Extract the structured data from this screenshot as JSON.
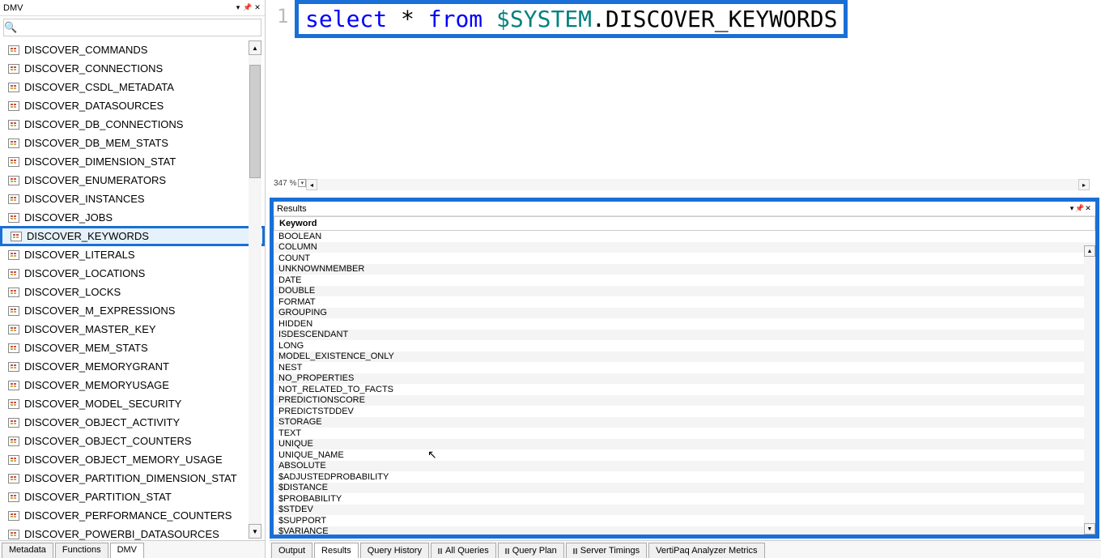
{
  "left": {
    "title": "DMV",
    "search_placeholder": "",
    "items": [
      "DISCOVER_COMMANDS",
      "DISCOVER_CONNECTIONS",
      "DISCOVER_CSDL_METADATA",
      "DISCOVER_DATASOURCES",
      "DISCOVER_DB_CONNECTIONS",
      "DISCOVER_DB_MEM_STATS",
      "DISCOVER_DIMENSION_STAT",
      "DISCOVER_ENUMERATORS",
      "DISCOVER_INSTANCES",
      "DISCOVER_JOBS",
      "DISCOVER_KEYWORDS",
      "DISCOVER_LITERALS",
      "DISCOVER_LOCATIONS",
      "DISCOVER_LOCKS",
      "DISCOVER_M_EXPRESSIONS",
      "DISCOVER_MASTER_KEY",
      "DISCOVER_MEM_STATS",
      "DISCOVER_MEMORYGRANT",
      "DISCOVER_MEMORYUSAGE",
      "DISCOVER_MODEL_SECURITY",
      "DISCOVER_OBJECT_ACTIVITY",
      "DISCOVER_OBJECT_COUNTERS",
      "DISCOVER_OBJECT_MEMORY_USAGE",
      "DISCOVER_PARTITION_DIMENSION_STAT",
      "DISCOVER_PARTITION_STAT",
      "DISCOVER_PERFORMANCE_COUNTERS",
      "DISCOVER_POWERBI_DATASOURCES"
    ],
    "selected_index": 10,
    "tabs": [
      "Metadata",
      "Functions",
      "DMV"
    ],
    "active_tab": 2
  },
  "editor": {
    "line_no": "1",
    "code_kw1": "select",
    "code_star": " * ",
    "code_kw2": "from",
    "code_sp": " ",
    "code_sys": "$SYSTEM",
    "code_dot": ".",
    "code_ident": "DISCOVER_KEYWORDS",
    "zoom": "347 %"
  },
  "results": {
    "title": "Results",
    "col": "Keyword",
    "rows": [
      "BOOLEAN",
      "COLUMN",
      "COUNT",
      "UNKNOWNMEMBER",
      "DATE",
      "DOUBLE",
      "FORMAT",
      "GROUPING",
      "HIDDEN",
      "ISDESCENDANT",
      "LONG",
      "MODEL_EXISTENCE_ONLY",
      "NEST",
      "NO_PROPERTIES",
      "NOT_RELATED_TO_FACTS",
      "PREDICTIONSCORE",
      "PREDICTSTDDEV",
      "STORAGE",
      "TEXT",
      "UNIQUE",
      "UNIQUE_NAME",
      "ABSOLUTE",
      "$ADJUSTEDPROBABILITY",
      "$DISTANCE",
      "$PROBABILITY",
      "$STDEV",
      "$SUPPORT",
      "$VARIANCE"
    ]
  },
  "bottom_tabs": {
    "items": [
      "Output",
      "Results",
      "Query History",
      "All Queries",
      "Query Plan",
      "Server Timings",
      "VertiPaq Analyzer Metrics"
    ],
    "active": 1,
    "paused": [
      3,
      4,
      5
    ]
  }
}
